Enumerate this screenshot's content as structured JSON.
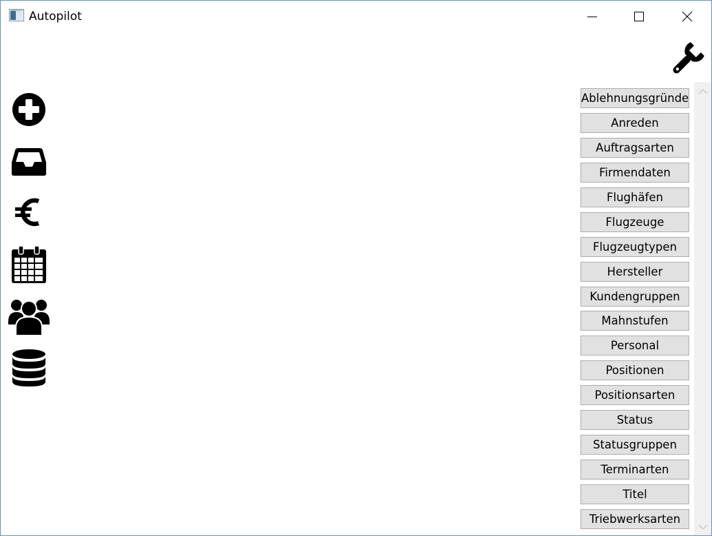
{
  "window": {
    "title": "Autopilot"
  },
  "icons": {
    "app": "app-window-icon",
    "settings": "wrench-icon",
    "left_nav": [
      "plus-circle-icon",
      "inbox-icon",
      "euro-icon",
      "calendar-icon",
      "users-icon",
      "database-icon"
    ]
  },
  "list": {
    "items": [
      "Ablehnungsgründe",
      "Anreden",
      "Auftragsarten",
      "Firmendaten",
      "Flughäfen",
      "Flugzeuge",
      "Flugzeugtypen",
      "Hersteller",
      "Kundengruppen",
      "Mahnstufen",
      "Personal",
      "Positionen",
      "Positionsarten",
      "Status",
      "Statusgruppen",
      "Terminarten",
      "Titel",
      "Triebwerksarten"
    ]
  },
  "colors": {
    "button_bg": "#e1e1e1",
    "button_border": "#adadad",
    "window_border": "#6b8fb4",
    "scrollbar_bg": "#f0f0f0"
  }
}
